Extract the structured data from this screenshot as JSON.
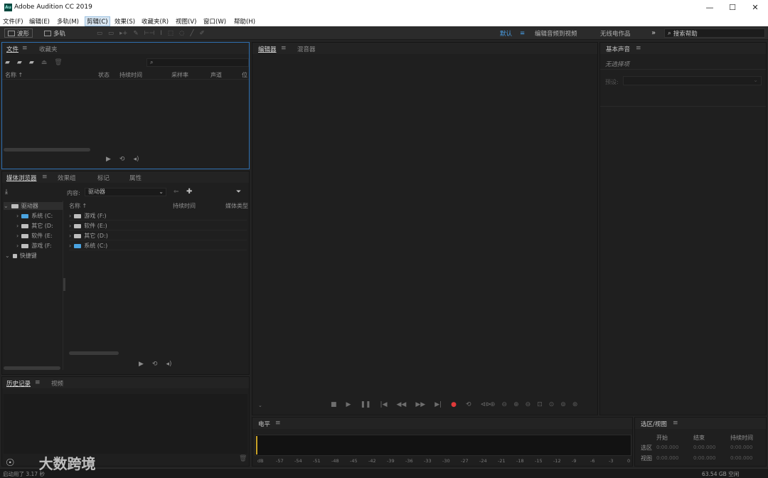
{
  "window": {
    "title": "Adobe Audition CC 2019",
    "app_icon": "Au",
    "controls": [
      "—",
      "☐",
      "✕"
    ]
  },
  "menu": [
    {
      "label": "文件(F)"
    },
    {
      "label": "编辑(E)"
    },
    {
      "label": "多轨(M)"
    },
    {
      "label": "剪辑(C)",
      "active": true
    },
    {
      "label": "效果(S)"
    },
    {
      "label": "收藏夹(R)"
    },
    {
      "label": "视图(V)"
    },
    {
      "label": "窗口(W)"
    },
    {
      "label": "帮助(H)"
    }
  ],
  "toolbar": {
    "waveform_label": "波形",
    "multitrack_label": "多轨",
    "workspace_default": "默认",
    "workspace_edit_video": "编辑音频到视频",
    "workspace_radio": "无线电作品",
    "more": "»",
    "search_placeholder": "搜索帮助"
  },
  "files_panel": {
    "tabs": [
      "文件",
      "收藏夹"
    ],
    "columns": [
      "名称 ↑",
      "状态",
      "持续时间",
      "采样率",
      "声道",
      "位"
    ]
  },
  "media_browser": {
    "tabs": [
      "媒体浏览器",
      "效果组",
      "标记",
      "属性"
    ],
    "content_label": "内容:",
    "content_value": "驱动器",
    "tree_root": "驱动器",
    "tree_items": [
      "系统 (C:",
      "其它 (D:",
      "软件 (E:",
      "游戏 (F:"
    ],
    "shortcuts": "快捷键",
    "list_columns": [
      "名称 ↑",
      "持续时间",
      "媒体类型"
    ],
    "list_items": [
      "游戏 (F:)",
      "软件 (E:)",
      "其它 (D:)",
      "系统 (C:)"
    ]
  },
  "history_panel": {
    "tabs": [
      "历史记录",
      "视频"
    ]
  },
  "editor": {
    "tabs": [
      "编辑器",
      "混音器"
    ]
  },
  "essential_sound": {
    "title": "基本声音",
    "no_selection": "无选择项",
    "preset_label": "预设:"
  },
  "levels": {
    "title": "电平",
    "scale": [
      "dB",
      "-57",
      "-54",
      "-51",
      "-48",
      "-45",
      "-42",
      "-39",
      "-36",
      "-33",
      "-30",
      "-27",
      "-24",
      "-21",
      "-18",
      "-15",
      "-12",
      "-9",
      "-6",
      "-3",
      "0"
    ]
  },
  "selection_view": {
    "title": "选区/视图",
    "headers": [
      "开始",
      "结束",
      "持续时间"
    ],
    "rows": [
      {
        "label": "选区",
        "start": "0:00.000",
        "end": "0:00.000",
        "duration": "0:00.000"
      },
      {
        "label": "视图",
        "start": "0:00.000",
        "end": "0:00.000",
        "duration": "0:00.000"
      }
    ]
  },
  "status": {
    "startup": "启动用了 3.17 秒",
    "disk": "63.54 GB 空闲"
  },
  "watermark": "大数跨境",
  "colors": {
    "accent": "#4a9fe6",
    "record": "#e03a3a",
    "panel_bg": "#1f1f1f"
  }
}
